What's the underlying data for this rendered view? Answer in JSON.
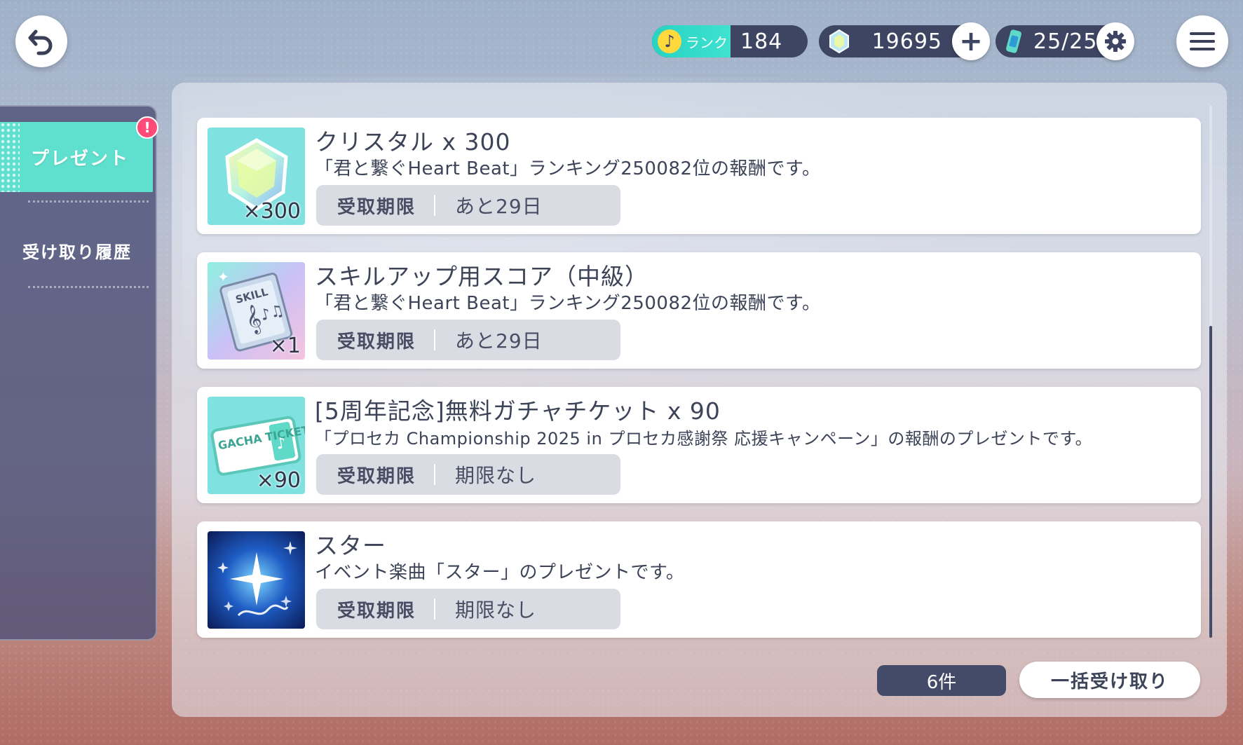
{
  "header": {
    "rank_label": "ランク",
    "rank_value": "184",
    "crystal_value": "19695",
    "energy_value": "25/25"
  },
  "sidebar": {
    "tabs": [
      {
        "label": "プレゼント",
        "active": true,
        "badge": "!"
      },
      {
        "label": "受け取り履歴",
        "active": false
      }
    ]
  },
  "presents": [
    {
      "title": "クリスタル x 300",
      "description": "「君と繋ぐHeart Beat」ランキング250082位の報酬です。",
      "quantity": "×300",
      "deadline_label": "受取期限",
      "deadline_value": "あと29日",
      "icon": "crystal-icon"
    },
    {
      "title": "スキルアップ用スコア（中級）",
      "description": "「君と繋ぐHeart Beat」ランキング250082位の報酬です。",
      "quantity": "×1",
      "deadline_label": "受取期限",
      "deadline_value": "あと29日",
      "icon": "skill-score-icon",
      "icon_text": "SKILL"
    },
    {
      "title": "[5周年記念]無料ガチャチケット x 90",
      "description": "「プロセカ Championship 2025 in プロセカ感謝祭 応援キャンペーン」の報酬のプレゼントです。",
      "quantity": "×90",
      "deadline_label": "受取期限",
      "deadline_value": "期限なし",
      "icon": "gacha-ticket-icon",
      "icon_text": "GACHA TICKET"
    },
    {
      "title": "スター",
      "description": "イベント楽曲「スター」のプレゼントです。",
      "quantity": "",
      "deadline_label": "受取期限",
      "deadline_value": "期限なし",
      "icon": "song-jacket-icon"
    }
  ],
  "footer": {
    "count": "6件",
    "bulk_receive": "一括受け取り"
  },
  "colors": {
    "accent": "#5fe0cf",
    "navy": "#3d4563",
    "badge": "#ff4b78"
  }
}
